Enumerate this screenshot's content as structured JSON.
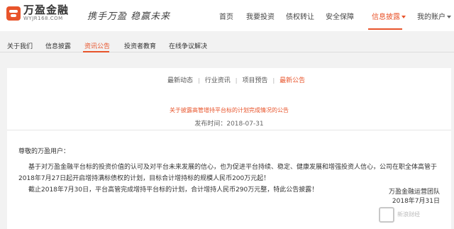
{
  "brand": {
    "name": "万盈金融",
    "url": "WYJR168.COM",
    "slogan": "携手万盈 稳赢未来",
    "accent_color": "#e8542b"
  },
  "nav": {
    "items": [
      {
        "label": "首页"
      },
      {
        "label": "我要投资"
      },
      {
        "label": "债权转让"
      },
      {
        "label": "安全保障"
      },
      {
        "label": "信息披露",
        "active": true
      },
      {
        "label": "我的账户"
      }
    ]
  },
  "subnav": {
    "items": [
      {
        "label": "关于我们"
      },
      {
        "label": "信息披露"
      },
      {
        "label": "资讯公告",
        "active": true
      },
      {
        "label": "投资者教育"
      },
      {
        "label": "在线争议解决"
      }
    ]
  },
  "tabs": {
    "items": [
      {
        "label": "最新动态"
      },
      {
        "label": "行业资讯"
      },
      {
        "label": "项目预告"
      },
      {
        "label": "最新公告",
        "active": true
      }
    ]
  },
  "article": {
    "title": "关于披露高管增持平台标的计划完成情况的公告",
    "date_label": "发布时间：2018-07-31",
    "greeting": "尊敬的万盈用户：",
    "paragraph1": "基于对万盈金融平台标的投资价值的认可及对平台未来发展的信心，也为促进平台持续、稳定、健康发展和增强投资人信心，公司在职全体高管于2018年7月27日起开启增持满标债权的计划，目标合计增持标的规模人民币200万元起！",
    "paragraph2": "截止2018年7月30日，平台高管完成增持平台标的计划，合计增持人民币290万元整，特此公告披露！",
    "signature_org": "万盈金融运营团队",
    "signature_date": "2018年7月31日"
  },
  "watermark": {
    "text": "新浪财经"
  }
}
